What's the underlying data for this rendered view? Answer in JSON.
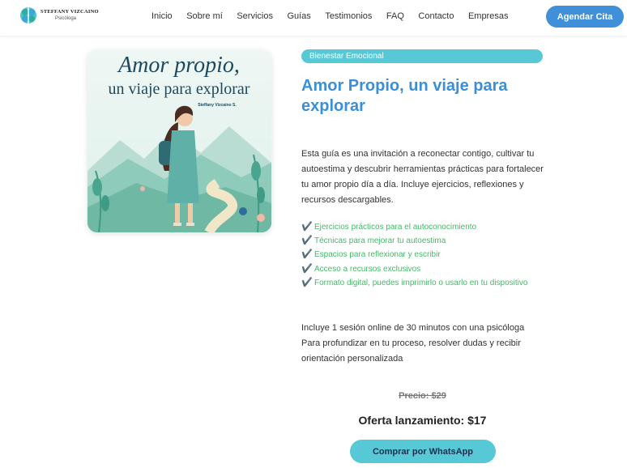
{
  "brand": {
    "name": "STEFFANY VIZCAINO",
    "subtitle": "Psicóloga",
    "colors": {
      "primary": "#3f8fd9",
      "accent": "#56c8d6",
      "success": "#45b86a"
    }
  },
  "nav": {
    "items": [
      {
        "label": "Inicio"
      },
      {
        "label": "Sobre mí"
      },
      {
        "label": "Servicios"
      },
      {
        "label": "Guías"
      },
      {
        "label": "Testimonios"
      },
      {
        "label": "FAQ"
      },
      {
        "label": "Contacto"
      },
      {
        "label": "Empresas"
      }
    ],
    "cta_label": "Agendar Cita"
  },
  "product": {
    "cover": {
      "title_line1": "Amor propio,",
      "title_line2": "un viaje para explorar",
      "author": "Steffany Vizcaino S."
    },
    "category": "Bienestar Emocional",
    "title": "Amor Propio, un viaje para explorar",
    "description": "Esta guía es una invitación a reconectar contigo, cultivar tu autoestima y descubrir herramientas prácticas para fortalecer tu amor propio día a día. Incluye ejercicios, reflexiones y recursos descargables.",
    "check_icon": "check-mark-icon",
    "features": [
      {
        "check": "✔️",
        "text": "Ejercicios prácticos para el autoconocimiento"
      },
      {
        "check": "✔️",
        "text": "Técnicas para mejorar tu autoestima"
      },
      {
        "check": "✔️",
        "text": "Espacios para reflexionar y escribir"
      },
      {
        "check": "✔️",
        "text": "Acceso a recursos exclusivos"
      },
      {
        "check": "✔️",
        "text": "Formato digital, puedes imprimirlo o usarlo en tu dispositivo"
      }
    ],
    "session_text": "Incluye 1 sesión online de 30 minutos con una psicóloga Para profundizar en tu proceso, resolver dudas y recibir orientación personalizada",
    "old_price": "Precio: $29",
    "offer_price": "Oferta lanzamiento: $17",
    "buy_label": "Comprar por WhatsApp"
  }
}
